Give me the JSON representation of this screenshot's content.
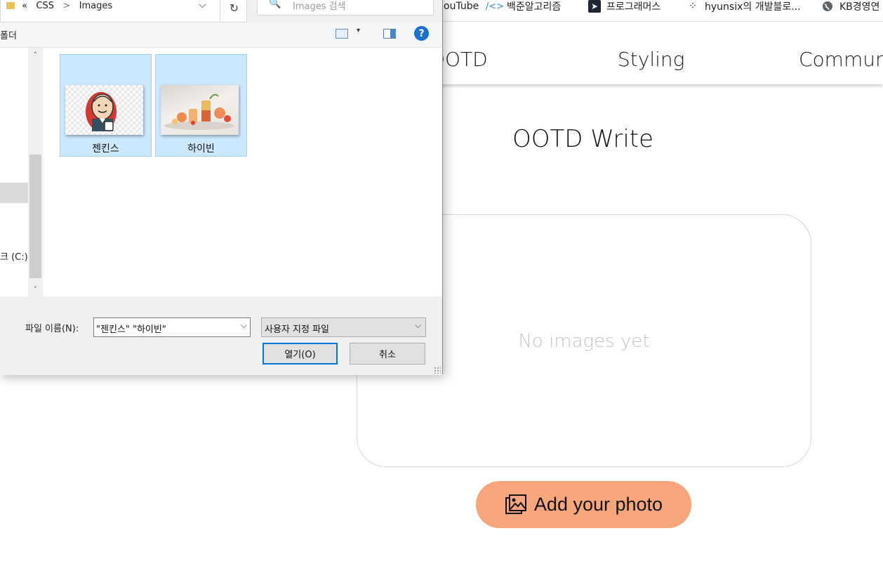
{
  "bookmarks": [
    {
      "label": "ouTube",
      "icon": "youtube-icon"
    },
    {
      "label": "백준알고리즘",
      "icon": "code-icon"
    },
    {
      "label": "프로그래머스",
      "icon": "programmers-icon"
    },
    {
      "label": "hyunsix의 개발블로...",
      "icon": "blog-icon"
    },
    {
      "label": "KB경영연",
      "icon": "globe-icon"
    }
  ],
  "nav": {
    "items": [
      "OOTD",
      "Styling",
      "Communi"
    ]
  },
  "page": {
    "title": "OOTD Write",
    "empty_text": "No images yet",
    "add_photo_label": "Add your photo",
    "accent_color": "#f7a57a"
  },
  "dialog": {
    "address": {
      "path_prefix": "«",
      "path_parts": [
        "CSS",
        "Images"
      ],
      "separator": ">",
      "dropdown": "⌵",
      "refresh": "↻"
    },
    "search": {
      "placeholder": "Images 검색",
      "icon": "🔍"
    },
    "toolbar": {
      "label": "폴더",
      "view_dropdown": "▾",
      "help": "?"
    },
    "nav_pane": {
      "drive_label": "크 (C:)",
      "scroll_up": "˄",
      "scroll_down": "˅"
    },
    "files": [
      {
        "name": "젠킨스",
        "selected": true
      },
      {
        "name": "하이빈",
        "selected": true
      }
    ],
    "filename_label": "파일 이름(N):",
    "filename_value": "\"젠킨스\" \"하이빈\"",
    "filetype_value": "사용자 지정 파일",
    "dropdown_arrow": "⌵",
    "open_label": "열기(O)",
    "cancel_label": "취소"
  }
}
